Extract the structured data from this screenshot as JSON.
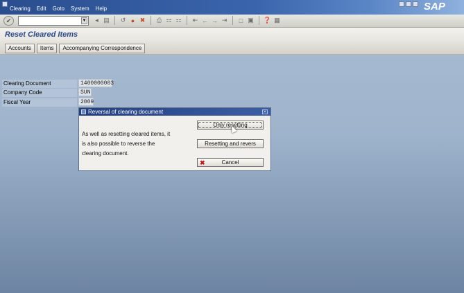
{
  "menu": {
    "items": [
      "Clearing",
      "Edit",
      "Goto",
      "System",
      "Help"
    ],
    "logo": "SAP"
  },
  "toolbar": {
    "command_field_value": "",
    "icons": [
      "back-icon",
      "exit-icon",
      "cancel-icon",
      "save-icon",
      "print-icon",
      "find-icon",
      "find-next-icon",
      "first-page-icon",
      "prev-page-icon",
      "next-page-icon",
      "last-page-icon",
      "new-session-icon",
      "shortcut-icon",
      "help-icon",
      "layout-icon"
    ]
  },
  "title": {
    "text": "Reset Cleared Items"
  },
  "app_toolbar": {
    "buttons": [
      "Accounts",
      "Items",
      "Accompanying Correspondence"
    ]
  },
  "fields": [
    {
      "label": "Clearing Document",
      "value": "1400000003"
    },
    {
      "label": "Company Code",
      "value": "SUN"
    },
    {
      "label": "Fiscal Year",
      "value": "2009"
    }
  ],
  "dialog": {
    "title": "Reversal of clearing document",
    "message": "As well as resetting cleared items, it is also possible to reverse the clearing document.",
    "buttons": {
      "only_resetting": "Only resetting",
      "resetting_and_reversing": "Resetting and revers",
      "cancel": "Cancel"
    }
  },
  "colors": {
    "menubar": "#3a65ad",
    "title_text": "#2b4a8c",
    "background": "#9fb4cc",
    "dialog_title": "#233f80",
    "cancel_icon": "#c4141b"
  }
}
